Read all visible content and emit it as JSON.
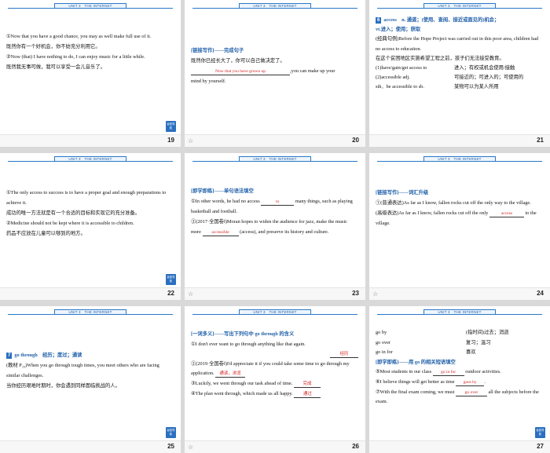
{
  "header_text": "UNIT 3　THE INTERNET",
  "nav_button": "返回导航",
  "slides": [
    {
      "page": "19",
      "lines": [
        "①Now that you have a good chance, you may as well make full use of it.",
        "既然你有一个好机会，你不妨充分利用它。",
        "②Now (that) I have nothing to do, I can enjoy music for a little while.",
        "既然我无事可做，我可以享受一会儿音乐了。"
      ]
    },
    {
      "page": "20",
      "title": "[链接写作]——完成句子",
      "line1": "既然你已经长大了，你可以自己做决定了。",
      "fill": "Now that you have grown up",
      "line2a": ",you can make up your",
      "line2b": "mind by yourself."
    },
    {
      "page": "21",
      "word_num": "6",
      "headword": "access　n. 通道；(使用、查阅、接近或面见的)机会；",
      "headword2": "vt.进入；使用；获取",
      "example": "(经典句例)Before the Hope Project was carried out in this poor area, children had no access to education.",
      "example_cn": "在这个贫困地区实施希望工程之前，孩子们无法接受教育。",
      "phrases": [
        {
          "en": "(1)have/gain/get access to",
          "cn": "进入；有权或机会使用/接触"
        },
        {
          "en": "(2)accessible adj.",
          "cn": "可接近的；可进入的；可使用的"
        },
        {
          "en": "sth．be accessible to sb.",
          "cn": "某物可以为某人所用"
        }
      ]
    },
    {
      "page": "22",
      "lines": [
        "①The only access to success is to have a proper goal and enough preparations to achieve it.",
        "成功的唯一方法就是有一个合适的目标和实现它的充分准备。",
        "②Medicine should not be kept where it is accessible to children.",
        "药品不应放在儿童可以够到的地方。"
      ]
    },
    {
      "page": "23",
      "title": "[即学即练]——单句语法填空",
      "q1a": "①In other words, he had no access",
      "q1fill": "to",
      "q1b": "many things, such as playing basketball and football.",
      "q2a": "②(2017·全国卷Ⅰ)Moran hopes to widen the audience for jazz, make the music more",
      "q2fill": "accessible",
      "q2b": "(access), and preserve its history and culture."
    },
    {
      "page": "24",
      "title": "[链接写作]——词汇升级",
      "s1": "①(普通表达)As far as I know, fallen rocks cut off the only way to the village.",
      "s2a": "(高级表达)As far as I know, fallen rocks cut off the only",
      "s2fill": "access",
      "s2b": "to the village."
    },
    {
      "page": "25",
      "word_num": "7",
      "headword": "go through　经历；度过；通读",
      "example": "(教材 P₂₀)When you go through tough times, you meet others who are facing similar challenges.",
      "example_cn": "当你经历艰难时期时，你会遇到同样面临挑战的人。"
    },
    {
      "page": "26",
      "title": "[一词多义]——写出下列句中 go through 的含义",
      "items": [
        {
          "text": "①I don't ever want to go through anything like that again.",
          "ans": "经历"
        },
        {
          "text": "②(2019·全国卷Ⅰ)I'd appreciate it if you could take some time to go through my application.",
          "ans": "通读，浏览"
        },
        {
          "text": "③Luckily, we went through our task ahead of time.",
          "ans": "完成"
        },
        {
          "text": "④The plan went through, which made us all happy.",
          "ans": "通过"
        }
      ]
    },
    {
      "page": "27",
      "phrases": [
        {
          "en": "go by",
          "cn": "(指时间)过去；消逝"
        },
        {
          "en": "go over",
          "cn": "复习；温习"
        },
        {
          "en": "go in for",
          "cn": "喜欢"
        }
      ],
      "title": "[即学即练]——用 go 的相关短语填空",
      "q5a": "⑤Most students in our class",
      "q5fill": "go in for",
      "q5b": "outdoor activities.",
      "q6a": "⑥I believe things will get better as time",
      "q6fill": "goes by",
      "q6b": ".",
      "q7a": "⑦With the final exam coming, we must",
      "q7fill": "go over",
      "q7b": "all the subjects before the exam."
    }
  ]
}
